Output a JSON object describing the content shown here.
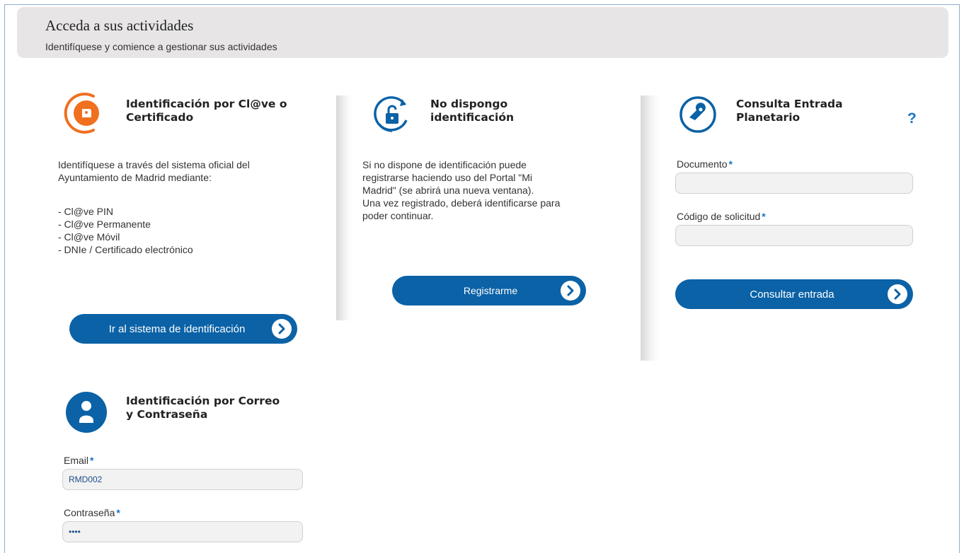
{
  "header": {
    "title": "Acceda a sus actividades",
    "subtitle": "Identifíquese y comience a gestionar sus actividades"
  },
  "clave": {
    "title_line1": "Identificación por Cl@ve o",
    "title_line2": "Certificado",
    "desc_line1": "Identifíquese a través del sistema oficial del",
    "desc_line2": "Ayuntamiento de Madrid mediante:",
    "options": [
      "- Cl@ve PIN",
      "- Cl@ve Permanente",
      "- Cl@ve Móvil",
      "- DNIe / Certificado electrónico"
    ],
    "button": "Ir al sistema de identificación",
    "icon": "clave-logo-icon"
  },
  "noid": {
    "title_line1": "No dispongo",
    "title_line2": "identificación",
    "desc_lines": [
      "Si no dispone de identificación puede",
      "registrarse haciendo uso del Portal \"Mi",
      "Madrid\" (se abrirá una nueva ventana).",
      "Una vez registrado, deberá identificarse para",
      "poder continuar."
    ],
    "button": "Registrarme",
    "icon": "unlock-icon"
  },
  "consulta": {
    "title_line1": "Consulta Entrada",
    "title_line2": "Planetario",
    "help": "?",
    "documento_label": "Documento",
    "codigo_label": "Código de solicitud",
    "required_mark": "*",
    "documento_value": "",
    "codigo_value": "",
    "button": "Consultar entrada",
    "icon": "ticket-icon"
  },
  "correo": {
    "title_line1": "Identificación por Correo",
    "title_line2": "y Contraseña",
    "email_label": "Email",
    "email_value": "RMD002",
    "password_label": "Contraseña",
    "password_value": "••••",
    "icon": "user-icon"
  },
  "colors": {
    "primary": "#0b62a6",
    "clave_orange": "#f07020",
    "required": "#1a73c8"
  }
}
